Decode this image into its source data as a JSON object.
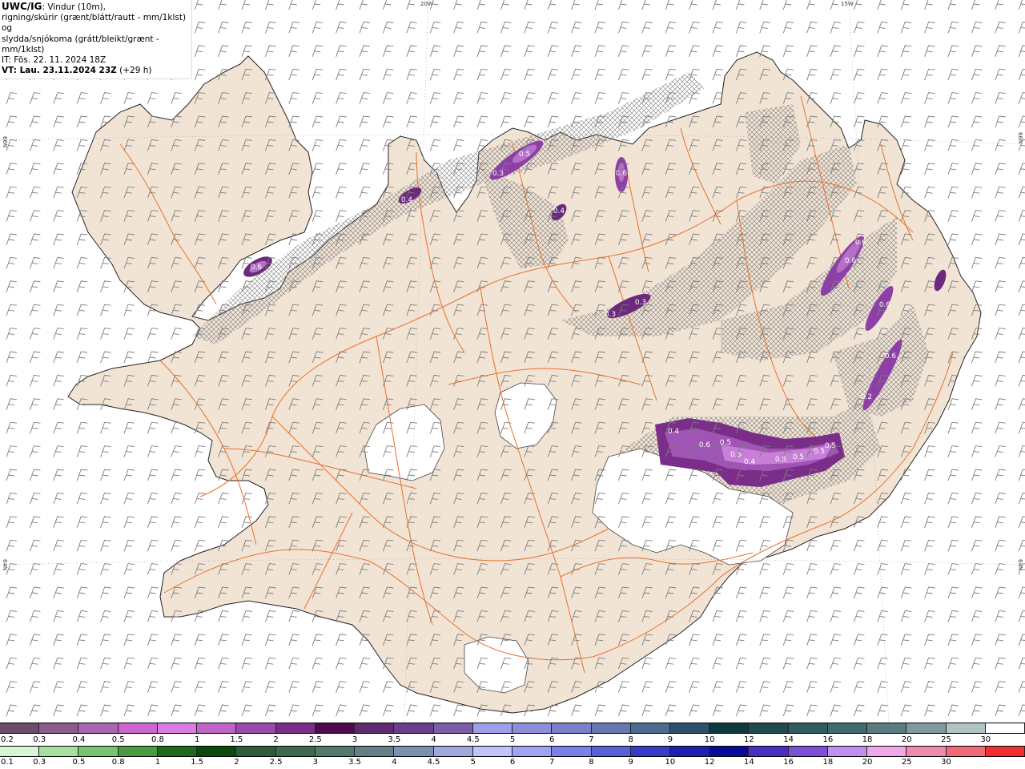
{
  "header": {
    "product": "UWC/IG",
    "line1_rest": ": Vindur (10m),",
    "line2": "rigning/skúrir (grænt/blátt/rautt - mm/1klst) og",
    "line3": "slydda/snjókoma (grátt/bleikt/grænt - mm/1klst)",
    "it": "IT: Fös. 22. 11. 2024 18Z",
    "vt_label": "VT: Lau. 23.11.2024 23Z",
    "vt_offset": " (+29 h)"
  },
  "graticule": {
    "top_left": "20W",
    "top_right": "15W",
    "left_upper": "66N",
    "right_upper": "66N",
    "left_lower": "64N",
    "right_lower": "64N"
  },
  "precip_labels": [
    "0.4",
    "0.5",
    "0.3",
    "0.6",
    "0.4",
    "0.6",
    "0.3",
    "0.3",
    "0.6",
    "0.6",
    "0.6",
    "0.6",
    "0.2",
    "0.4",
    "0.6",
    "0.5",
    "0.5",
    "0.4",
    "0.5",
    "0.5",
    "0.5",
    "0.5"
  ],
  "colors": {
    "land": "#f2e4d5",
    "coast": "#222222",
    "roads": "#e8702a",
    "glacier": "#ffffff",
    "precip_light": "#b570c8",
    "precip_mid": "#8e3fa6",
    "precip_dark": "#6b2a7c",
    "hatch": "#8a8a8a",
    "barb": "#7d7d7d"
  },
  "legend_snow": {
    "labels": [
      "0.2",
      "0.3",
      "0.4",
      "0.5",
      "0.8",
      "1",
      "1.5",
      "2",
      "2.5",
      "3",
      "3.5",
      "4",
      "4.5",
      "5",
      "6",
      "7",
      "8",
      "9",
      "10",
      "12",
      "14",
      "16",
      "18",
      "20",
      "25",
      "30"
    ],
    "colors": [
      "#6b4d6b",
      "#8c5c8c",
      "#a866b0",
      "#cc66cc",
      "#d97ee0",
      "#c065c8",
      "#9a4aa8",
      "#7a2e8a",
      "#4d0b4d",
      "#5e2a70",
      "#6a3d8a",
      "#7a5fa8",
      "#9f9ee8",
      "#8e8ed8",
      "#7a80c8",
      "#6678b0",
      "#4d6a90",
      "#2e506a",
      "#0c3a3e",
      "#1e4a50",
      "#2e5c60",
      "#406a70",
      "#587c80",
      "#7e9a9a",
      "#b0c4c4",
      "#ffffff"
    ]
  },
  "legend_rain": {
    "labels": [
      "0.1",
      "0.3",
      "0.5",
      "0.8",
      "1",
      "1.5",
      "2",
      "2.5",
      "3",
      "3.5",
      "4",
      "4.5",
      "5",
      "6",
      "7",
      "8",
      "9",
      "10",
      "12",
      "14",
      "16",
      "18",
      "20",
      "25",
      "30"
    ],
    "colors": [
      "#d8f5d8",
      "#a8e0a0",
      "#78c270",
      "#4a9a40",
      "#1f6a1a",
      "#0a4a0a",
      "#2e5c3a",
      "#3e6a50",
      "#527a68",
      "#667e88",
      "#7e90b0",
      "#a0a8e0",
      "#c0c4f8",
      "#a0a4f0",
      "#7a80e8",
      "#5a60d8",
      "#3a3ac8",
      "#1e1eb0",
      "#0a0a9a",
      "#4a2ec0",
      "#7a50d8",
      "#c090f0",
      "#f0a8e8",
      "#f08ab0",
      "#f06a78",
      "#f03030"
    ]
  }
}
